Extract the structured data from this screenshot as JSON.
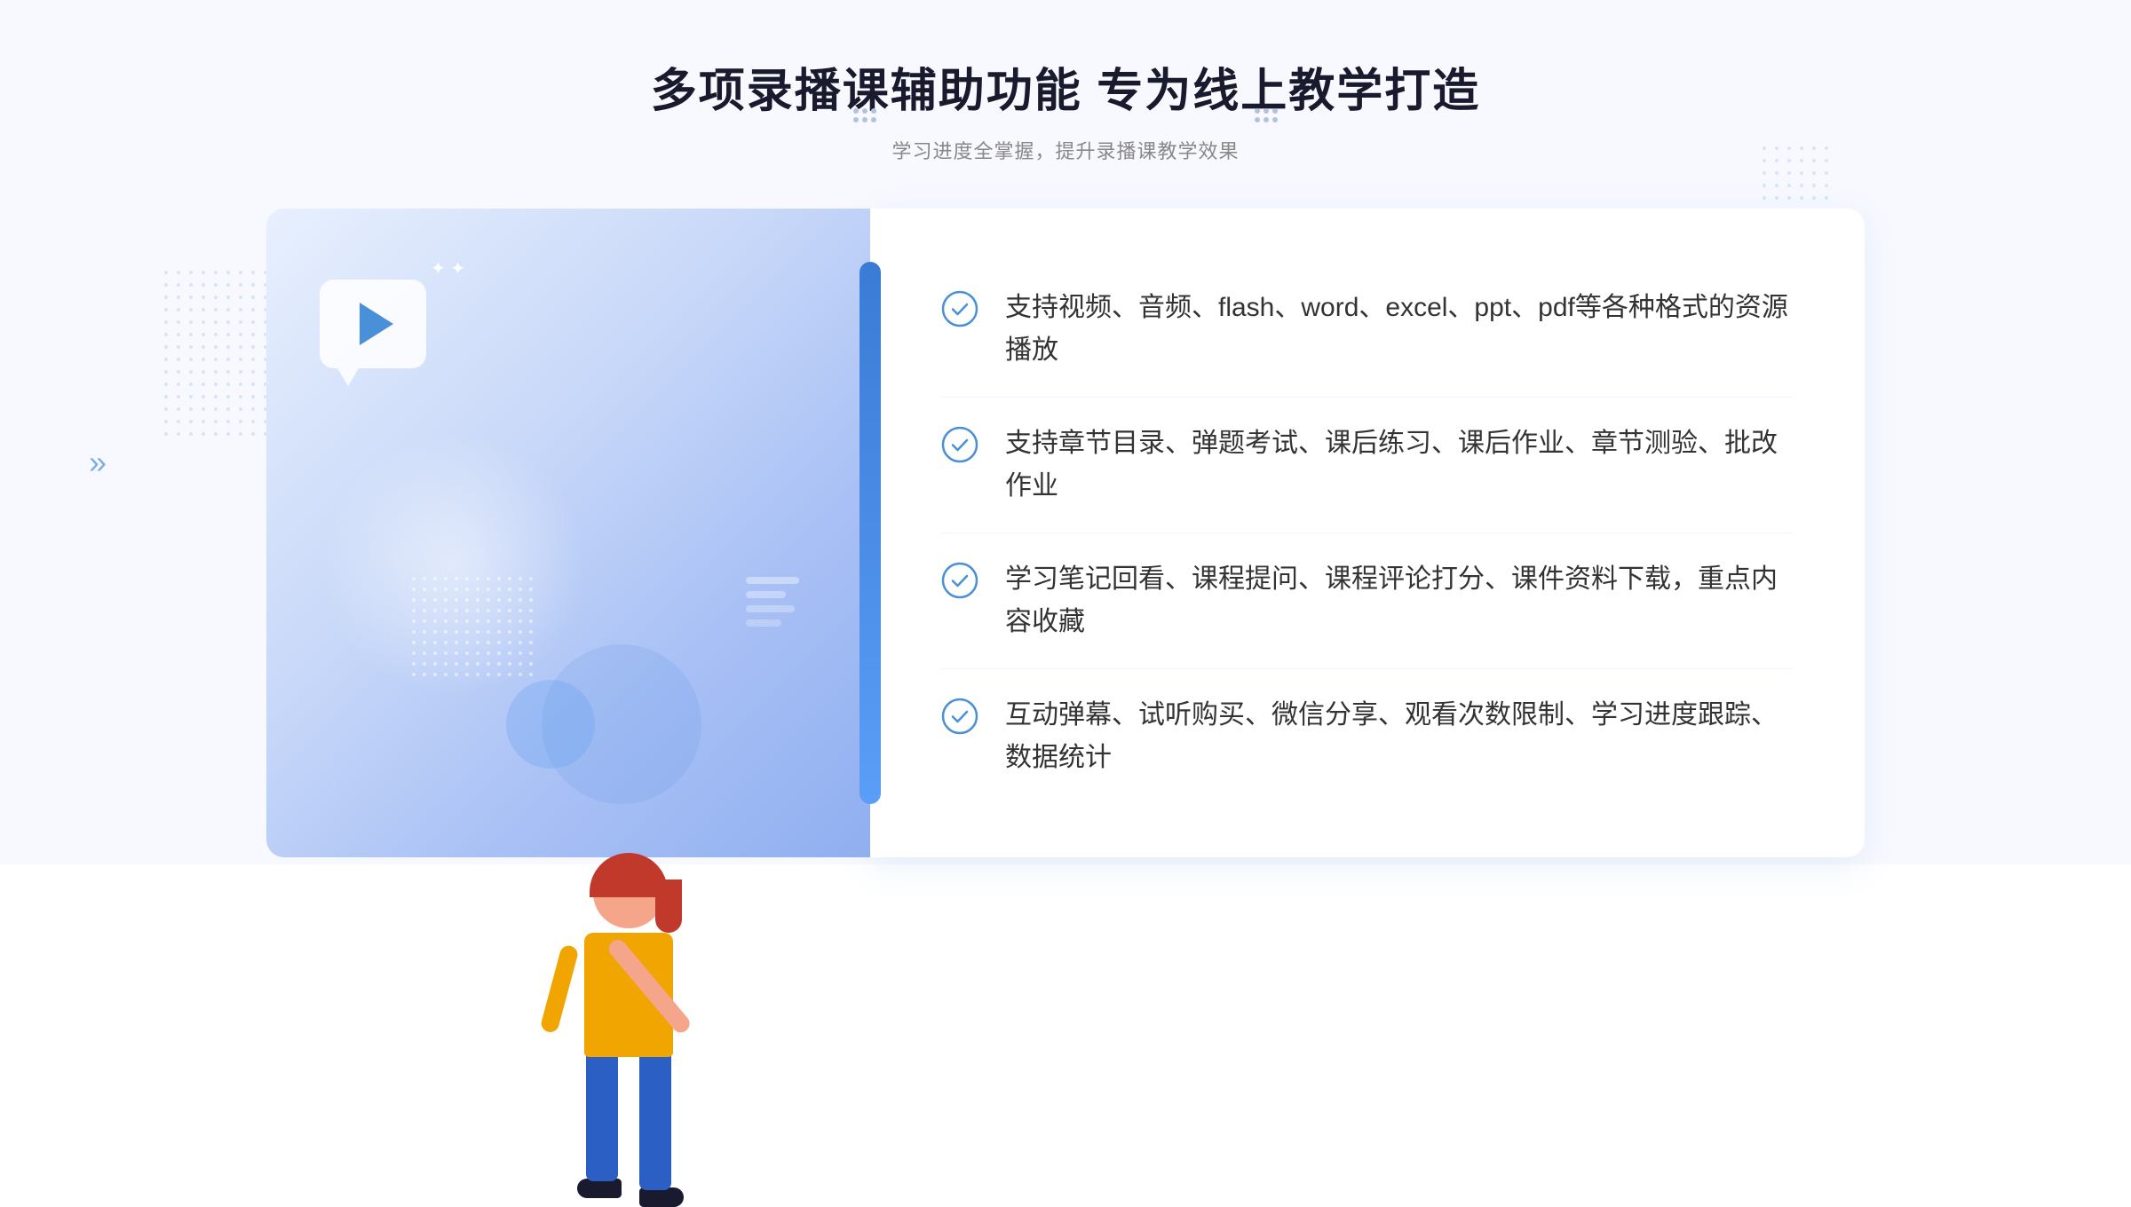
{
  "page": {
    "background_color": "#f5f7ff"
  },
  "header": {
    "title": "多项录播课辅助功能 专为线上教学打造",
    "subtitle": "学习进度全掌握，提升录播课教学效果",
    "title_dots": "····"
  },
  "features": [
    {
      "id": 1,
      "text": "支持视频、音频、flash、word、excel、ppt、pdf等各种格式的资源播放"
    },
    {
      "id": 2,
      "text": "支持章节目录、弹题考试、课后练习、课后作业、章节测验、批改作业"
    },
    {
      "id": 3,
      "text": "学习笔记回看、课程提问、课程评论打分、课件资料下载，重点内容收藏"
    },
    {
      "id": 4,
      "text": "互动弹幕、试听购买、微信分享、观看次数限制、学习进度跟踪、数据统计"
    }
  ],
  "colors": {
    "primary_blue": "#4a90d9",
    "light_blue": "#e8f0fe",
    "check_color": "#4a90d9",
    "title_color": "#1a1a2e",
    "text_color": "#333333",
    "subtitle_color": "#999999"
  },
  "decoration": {
    "chevron_left": "»",
    "play_icon": "▶"
  }
}
